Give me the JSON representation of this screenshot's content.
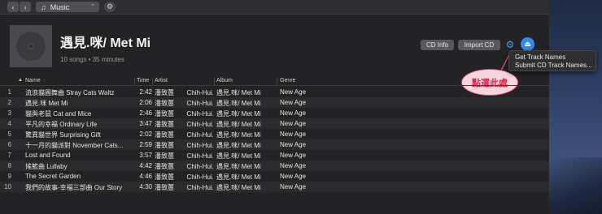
{
  "toolbar": {
    "back_icon": "‹",
    "forward_icon": "›",
    "media_icon": "♫",
    "media_label": "Music",
    "media_chevron": "⌃",
    "settings_icon": "⚙"
  },
  "album": {
    "title": "遇見.咪/ Met Mi",
    "subtitle": "10 songs • 35 minutes"
  },
  "actions": {
    "cd_info": "CD Info",
    "import_cd": "Import CD",
    "gear_icon": "⚙",
    "eject_icon": "⏏"
  },
  "menu": {
    "items": [
      "Get Track Names",
      "Submit CD Track Names..."
    ]
  },
  "callout": {
    "text": "點選此處",
    "color": "#e0224f"
  },
  "columns": {
    "name": "Name",
    "time": "Time",
    "artist": "Artist",
    "album": "Album",
    "genre": "Genre"
  },
  "tracks": [
    {
      "num": "1",
      "name": "流浪貓圓舞曲 Stray Cats Waltz",
      "time": "2:42",
      "artist": "潘致蕙       Chih-Hui...",
      "album": "遇見.咪/ Met Mi",
      "genre": "New Age"
    },
    {
      "num": "2",
      "name": "遇見.咪 Met Mi",
      "time": "2:06",
      "artist": "潘致蕙       Chih-Hui...",
      "album": "遇見.咪/ Met Mi",
      "genre": "New Age"
    },
    {
      "num": "3",
      "name": "貓與老鼠 Cat and Mice",
      "time": "2:46",
      "artist": "潘致蕙       Chih-Hui...",
      "album": "遇見.咪/ Met Mi",
      "genre": "New Age"
    },
    {
      "num": "4",
      "name": "平凡的幸福 Ordinary Life",
      "time": "3:47",
      "artist": "潘致蕙       Chih-Hui...",
      "album": "遇見.咪/ Met Mi",
      "genre": "New Age"
    },
    {
      "num": "5",
      "name": "驚異貓世界 Surprising Gift",
      "time": "2:02",
      "artist": "潘致蕙       Chih-Hui...",
      "album": "遇見.咪/ Met Mi",
      "genre": "New Age"
    },
    {
      "num": "6",
      "name": "十一月的貓派對 November Cats...",
      "time": "2:59",
      "artist": "潘致蕙       Chih-Hui...",
      "album": "遇見.咪/ Met Mi",
      "genre": "New Age"
    },
    {
      "num": "7",
      "name": "Lost and Found",
      "time": "3:57",
      "artist": "潘致蕙       Chih-Hui...",
      "album": "遇見.咪/ Met Mi",
      "genre": "New Age"
    },
    {
      "num": "8",
      "name": "搖籃曲 Lullaby",
      "time": "4:42",
      "artist": "潘致蕙       Chih-Hui...",
      "album": "遇見.咪/ Met Mi",
      "genre": "New Age"
    },
    {
      "num": "9",
      "name": "The Secret Garden",
      "time": "4:46",
      "artist": "潘致蕙       Chih-Hui...",
      "album": "遇見.咪/ Met Mi",
      "genre": "New Age"
    },
    {
      "num": "10",
      "name": "我們的故事-幸福三部曲 Our Story",
      "time": "4:30",
      "artist": "潘致蕙       Chih-Hui...",
      "album": "遇見.咪/ Met Mi",
      "genre": "New Age"
    }
  ]
}
